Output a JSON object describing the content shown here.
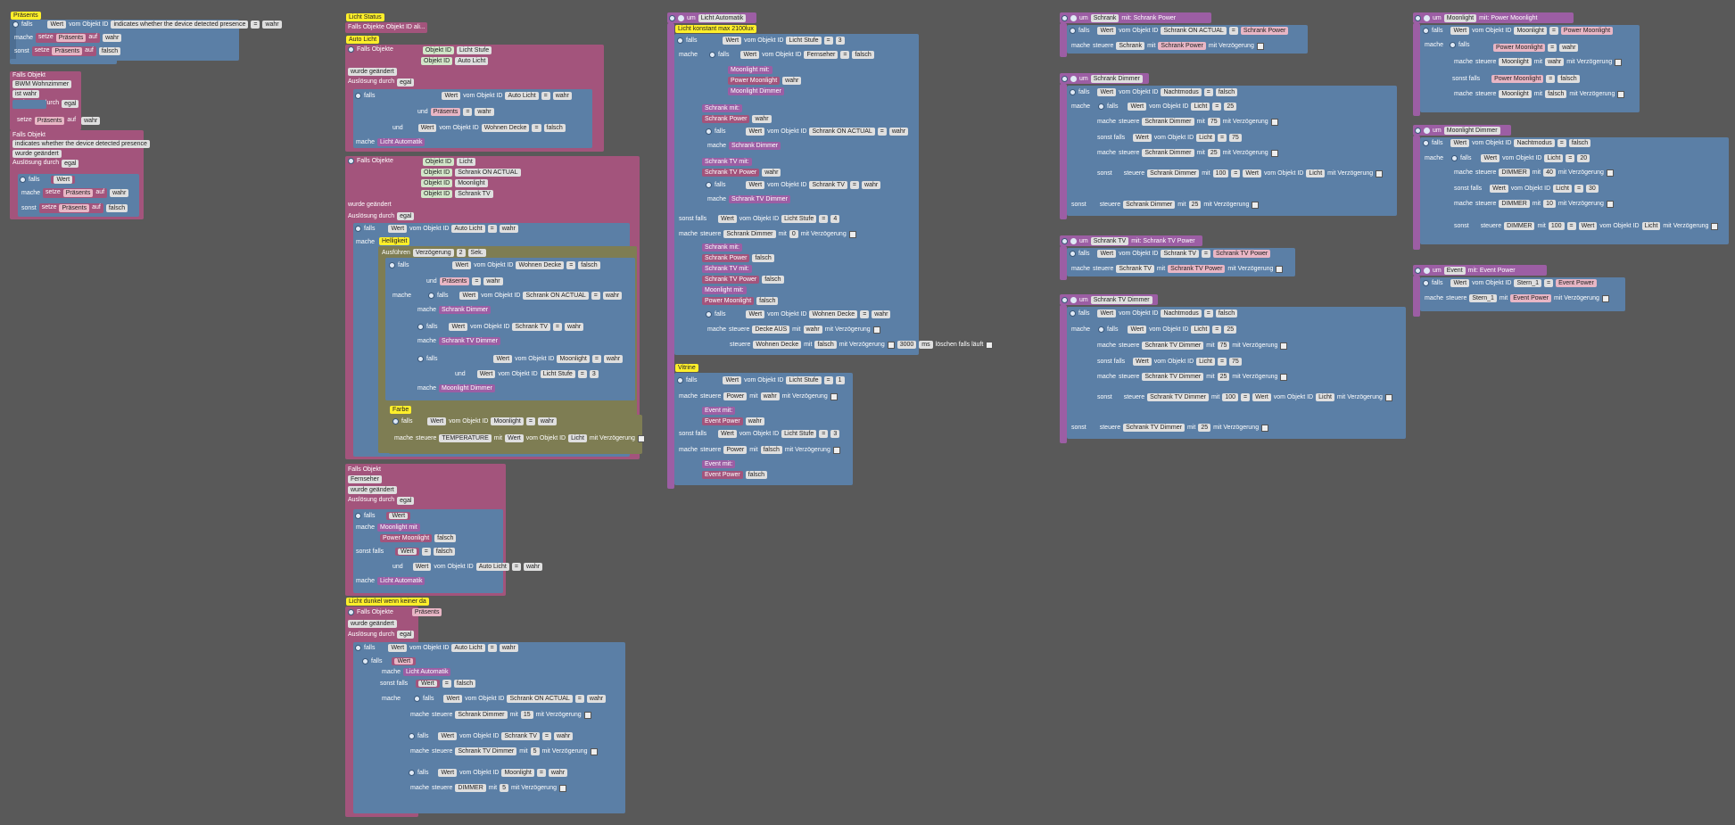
{
  "workspace": {
    "background": "#595959"
  },
  "col1": {
    "title": "Präsents",
    "falls": "falls",
    "wert": "Wert",
    "vom_objekt": "vom Objekt ID",
    "obj1": "indicates whether the device detected presence",
    "op_eq": "=",
    "wahr": "wahr",
    "falsch": "falsch",
    "mache": "mache",
    "setze": "setze",
    "praesents": "Präsents",
    "auf": "auf",
    "sonst": "sonst",
    "falls_objekt": "Falls Objekt",
    "bwm": "BWM Wohnzimmer",
    "ist_wahr": "ist wahr",
    "ausloesung": "Auslösung durch",
    "egal": "egal",
    "wurde_geaendert": "wurde geändert"
  },
  "col2": {
    "licht_status": "Licht Status",
    "falls_objekte_id": "Falls Objekte Objekt ID ali...",
    "auto_licht": "Auto Licht",
    "falls_objekte": "Falls Objekte",
    "objekt_id": "Objekt ID",
    "licht_stufe": "Licht Stufe",
    "auto_licht2": "Auto Licht",
    "wurde_geaendert": "wurde geändert",
    "ausloesung": "Auslösung durch",
    "egal": "egal",
    "wohnen_decke": "Wohnen Decke",
    "und": "und",
    "licht_automatik": "Licht Automatik",
    "licht": "Licht",
    "schrank_on_actual": "Schrank ON ACTUAL",
    "moonlight": "Moonlight",
    "schrank_tv": "Schrank TV",
    "helligkeit": "Helligkeit",
    "ausfuehren": "Ausführen",
    "verzoegerung": "Verzögerung",
    "zwei": "2",
    "sek": "Sek.",
    "fernseher": "Fernseher",
    "schrank_dimmer": "Schrank Dimmer",
    "schrank_tv_dimmer": "Schrank TV Dimmer",
    "drei": "3",
    "moonlight_dimmer": "Moonlight Dimmer",
    "farbe": "Farbe",
    "steuere": "steuere",
    "temperature": "TEMPERATURE",
    "mit": "mit",
    "mit_verz": "mit Verzögerung",
    "falls_objekt": "Falls Objekt",
    "sonst_falls": "sonst falls",
    "power_moonlight": "Power Moonlight",
    "licht_dunkel": "Licht dunkel wenn keiner da",
    "praesents": "Präsents",
    "n15": "15",
    "n5": "5",
    "dimmer": "DIMMER"
  },
  "col3": {
    "um": "um",
    "licht_automatik": "Licht Automatik",
    "konstant": "Licht konstant max 2100lux",
    "licht_stufe": "Licht Stufe",
    "n3": "3",
    "n4": "4",
    "n1": "1",
    "n0": "0",
    "fernseher": "Fernseher",
    "moonlight": "Moonlight",
    "power_moonlight": "Power Moonlight",
    "moonlight_dimmer": "Moonlight Dimmer",
    "schrank": "Schrank",
    "schrank_power": "Schrank Power",
    "schrank_on_actual": "Schrank ON ACTUAL",
    "schrank_dimmer": "Schrank Dimmer",
    "schrank_tv": "Schrank TV",
    "schrank_tv_power": "Schrank TV Power",
    "schrank_tv_dimmer": "Schrank TV Dimmer",
    "wohnen_decke": "Wohnen Decke",
    "decke_aus": "Decke AUS",
    "n3000": "3000",
    "ms": "ms",
    "loeschen": "löschen falls läuft",
    "vitrine": "Vitrine",
    "power": "Power",
    "event": "Event",
    "event_power": "Event Power",
    "mit_colon": "mit:"
  },
  "col4": {
    "schrank": "Schrank",
    "mit_schrank_power": "mit: Schrank Power",
    "schrank_on_actual": "Schrank ON ACTUAL",
    "schrank_power": "Schrank Power",
    "schrank_dimmer": "Schrank Dimmer",
    "nachtmodus": "Nachtmodus",
    "licht": "Licht",
    "n25": "25",
    "n75": "75",
    "n100": "100",
    "sonst": "sonst",
    "schrank_tv": "Schrank TV",
    "mit_schrank_tv_power": "mit: Schrank TV Power",
    "schrank_tv_power": "Schrank TV Power",
    "schrank_tv_dimmer": "Schrank TV Dimmer"
  },
  "col5": {
    "moonlight": "Moonlight",
    "mit_power_moonlight": "mit: Power Moonlight",
    "power_moonlight": "Power Moonlight",
    "moonlight_dimmer": "Moonlight Dimmer",
    "nachtmodus": "Nachtmodus",
    "licht": "Licht",
    "dimmer": "DIMMER",
    "n20": "20",
    "n40": "40",
    "n30": "30",
    "n10": "10",
    "n100": "100",
    "event": "Event",
    "mit_event_power": "mit: Event Power",
    "stern1": "Stern_1",
    "event_power": "Event Power"
  }
}
